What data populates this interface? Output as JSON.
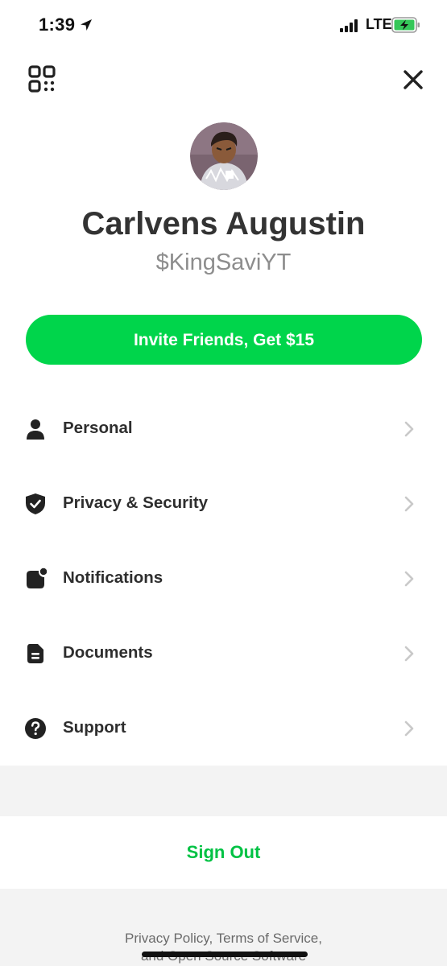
{
  "status_bar": {
    "time": "1:39",
    "network": "LTE",
    "icons": [
      "location-arrow-icon",
      "signal-bars-icon",
      "battery-charging-icon"
    ]
  },
  "header": {
    "left_icon": "qr-code-icon",
    "right_icon": "close-icon"
  },
  "profile": {
    "name": "Carlvens Augustin",
    "cashtag": "$KingSaviYT",
    "avatar_icon": "cartoon-avatar"
  },
  "invite_button": {
    "label": "Invite Friends, Get $15",
    "color": "#00d54b"
  },
  "menu": {
    "items": [
      {
        "label": "Personal",
        "icon": "person-icon"
      },
      {
        "label": "Privacy & Security",
        "icon": "shield-check-icon"
      },
      {
        "label": "Notifications",
        "icon": "notification-badge-icon"
      },
      {
        "label": "Documents",
        "icon": "document-icon"
      },
      {
        "label": "Support",
        "icon": "question-circle-icon"
      }
    ]
  },
  "sign_out": {
    "label": "Sign Out",
    "color": "#00c244"
  },
  "footer": {
    "line1": "Privacy Policy, Terms of Service,",
    "line2": "and Open Source Software"
  }
}
